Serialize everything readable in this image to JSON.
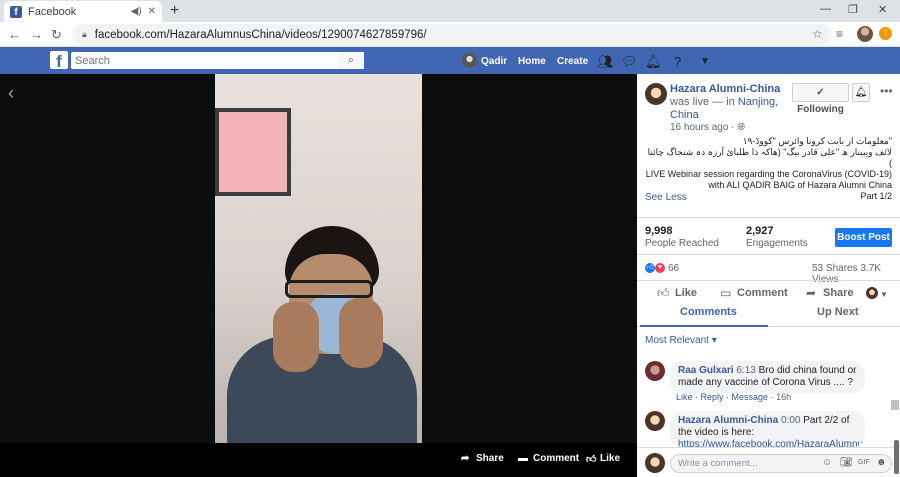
{
  "browser": {
    "tab_title": "Facebook",
    "new_tab_label": "+",
    "url": "facebook.com/HazaraAlumnusChina/videos/1290074627859796/"
  },
  "fb_header": {
    "search_placeholder": "Search",
    "user_name": "Qadir",
    "home": "Home",
    "create": "Create"
  },
  "video_actions": {
    "share": "Share",
    "comment": "Comment",
    "like": "Like"
  },
  "post": {
    "page_name": "Hazara Alumni-China",
    "live_prefix": "was live — in",
    "location": "Nanjing, China",
    "time_ago": "16 hours ago ·",
    "follow_label": "Following",
    "text_line1": "معلومات از بابت کرونا وائرس \"کووڈ-١٩\"",
    "text_line2": "لائف ویبینار ھ \"علی قادر بیگ\" (ھاکہ ذا طلبائ آرزہ دہ شنجاگ چائنا )",
    "text_line3": "LIVE Webinar session regarding the CoronaVirus (COVID-19) with ALI QADIR BAIG of Hazara Alumni China",
    "text_line4": "Part 1/2",
    "see_less": "See Less"
  },
  "insights": {
    "reached_value": "9,998",
    "reached_label": "People Reached",
    "engagements_value": "2,927",
    "engagements_label": "Engagements",
    "boost_label": "Boost Post"
  },
  "reactions": {
    "count": "66",
    "shares_views": "53 Shares  3.7K Views"
  },
  "actions": {
    "like": "Like",
    "comment": "Comment",
    "share": "Share"
  },
  "tabs": {
    "comments": "Comments",
    "up_next": "Up Next"
  },
  "sort_label": "Most Relevant ▾",
  "comments": [
    {
      "name": "Raa Gulxari",
      "time": "6:13",
      "text": "Bro did china found or made any vaccine of Corona Virus .... ?",
      "like": "Like",
      "reply": "Reply",
      "message": "Message",
      "age": "16h"
    },
    {
      "name": "Hazara Alumni-China",
      "time": "0:00",
      "text": "Part 2/2 of the video is here:",
      "link": "https://www.facebook.com/HazaraAlumnusChin"
    }
  ],
  "comment_placeholder": "Write a comment...",
  "icons": [
    "facebook-favicon",
    "speaker-icon",
    "close-icon",
    "back-arrow-icon",
    "forward-arrow-icon",
    "reload-icon",
    "lock-icon",
    "star-icon",
    "media-icon",
    "search-icon",
    "friends-icon",
    "messenger-icon",
    "bell-icon",
    "help-icon",
    "caret-down-icon",
    "share-icon",
    "comment-icon",
    "like-icon",
    "globe-icon",
    "emoji-icon",
    "camera-icon",
    "gif-icon",
    "sticker-icon"
  ],
  "colors": {
    "fb_blue": "#4267b2",
    "link_blue": "#385898",
    "boost_blue": "#1877f2"
  }
}
